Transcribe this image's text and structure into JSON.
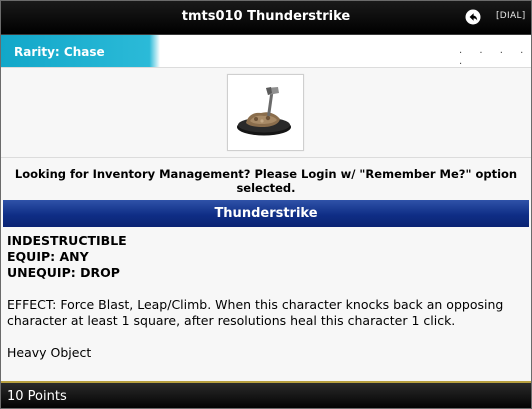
{
  "window": {
    "title": "tmts010 Thunderstrike",
    "back_icon": "back-arrow-icon",
    "dial_label": "[DIAL]"
  },
  "rarity": {
    "label": "Rarity: Chase",
    "dots": ". . . . ."
  },
  "figure": {
    "image_name": "thunderstrike-figure-icon"
  },
  "notice": {
    "text": "Looking for Inventory Management? Please Login w/ \"Remember Me?\" option selected."
  },
  "card": {
    "name": "Thunderstrike",
    "keywords": [
      "INDESTRUCTIBLE",
      "EQUIP: ANY",
      "UNEQUIP: DROP"
    ],
    "effect": "EFFECT: Force Blast, Leap/Climb. When this character knocks back an opposing character at least 1 square, after resolutions heal this character 1 click.",
    "type": "Heavy Object"
  },
  "footer": {
    "points": "10 Points"
  },
  "colors": {
    "titlebar": "#000000",
    "rarity_accent": "#12a7c9",
    "section_header": "#0f2e86",
    "footer_border": "#b8a040"
  }
}
